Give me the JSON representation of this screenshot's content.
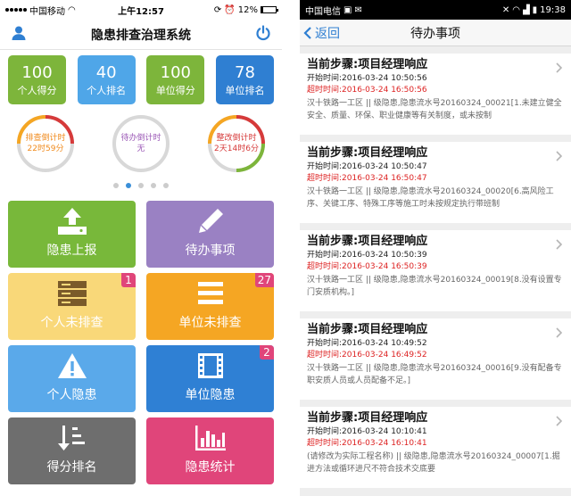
{
  "left": {
    "status": {
      "carrier": "中国移动",
      "wifi_icon": "wifi-icon",
      "time": "上午12:57",
      "battery": "12%",
      "battery_level": 0.12
    },
    "nav": {
      "title": "隐患排查治理系统",
      "left_icon": "user-icon",
      "right_icon": "power-icon"
    },
    "stats": [
      {
        "value": "100",
        "label": "个人得分",
        "color": "#7db53b"
      },
      {
        "value": "40",
        "label": "个人排名",
        "color": "#4fa6e8"
      },
      {
        "value": "100",
        "label": "单位得分",
        "color": "#7db53b"
      },
      {
        "value": "78",
        "label": "单位排名",
        "color": "#2f7fd2"
      }
    ],
    "timers": [
      {
        "title": "排查倒计时",
        "value": "22时59分",
        "color": "#f08a1c"
      },
      {
        "title": "待办倒计时",
        "value": "无",
        "color": "#9b59b6"
      },
      {
        "title": "整改倒计时",
        "value": "2天14时6分",
        "color": "#d63a3a"
      }
    ],
    "pager_active": 1,
    "tiles": [
      {
        "label": "隐患上报",
        "icon": "upload-icon",
        "color": "#78b83a",
        "badge": ""
      },
      {
        "label": "待办事项",
        "icon": "pencil-icon",
        "color": "#9a81c3",
        "badge": ""
      },
      {
        "label": "个人未排查",
        "icon": "server-icon",
        "color": "#f9d879",
        "badge": "1"
      },
      {
        "label": "单位未排查",
        "icon": "menu-icon",
        "color": "#f5a623",
        "badge": "27"
      },
      {
        "label": "个人隐患",
        "icon": "warning-icon",
        "color": "#5aa9ea",
        "badge": ""
      },
      {
        "label": "单位隐患",
        "icon": "film-icon",
        "color": "#2f80d4",
        "badge": "2"
      },
      {
        "label": "得分排名",
        "icon": "sort-icon",
        "color": "#6e6e6e",
        "badge": ""
      },
      {
        "label": "隐患统计",
        "icon": "bar-chart-icon",
        "color": "#e0457a",
        "badge": ""
      }
    ]
  },
  "right": {
    "status": {
      "carrier": "中国电信",
      "time": "19:38"
    },
    "nav": {
      "back": "返回",
      "title": "待办事项"
    },
    "tasks": [
      {
        "step": "当前步骤:项目经理响应",
        "start": "开始时间:2016-03-24 10:50:56",
        "over": "超时时间:2016-03-24 16:50:56",
        "desc": "汉十铁路一工区 || 级隐患,隐患流水号20160324_00021[1.未建立健全安全、质量、环保、职业健康等有关制度，或未按制"
      },
      {
        "step": "当前步骤:项目经理响应",
        "start": "开始时间:2016-03-24 10:50:47",
        "over": "超时时间:2016-03-24 16:50:47",
        "desc": "汉十铁路一工区 || 级隐患,隐患流水号20160324_00020[6.高风险工序、关键工序、特殊工序等施工时未按规定执行带班制"
      },
      {
        "step": "当前步骤:项目经理响应",
        "start": "开始时间:2016-03-24 10:50:39",
        "over": "超时时间:2016-03-24 16:50:39",
        "desc": "汉十铁路一工区 || 级隐患,隐患流水号20160324_00019[8.没有设置专门安质机构。]"
      },
      {
        "step": "当前步骤:项目经理响应",
        "start": "开始时间:2016-03-24 10:49:52",
        "over": "超时时间:2016-03-24 16:49:52",
        "desc": "汉十铁路一工区 || 级隐患,隐患流水号20160324_00016[9.没有配备专职安质人员或人员配备不足。]"
      },
      {
        "step": "当前步骤:项目经理响应",
        "start": "开始时间:2016-03-24 10:10:41",
        "over": "超时时间:2016-03-24 16:10:41",
        "desc": "(请修改为实际工程名称) || 级隐患,隐患流水号20160324_00007[1.掘进方法或循环进尺不符合技术交底要"
      }
    ]
  }
}
